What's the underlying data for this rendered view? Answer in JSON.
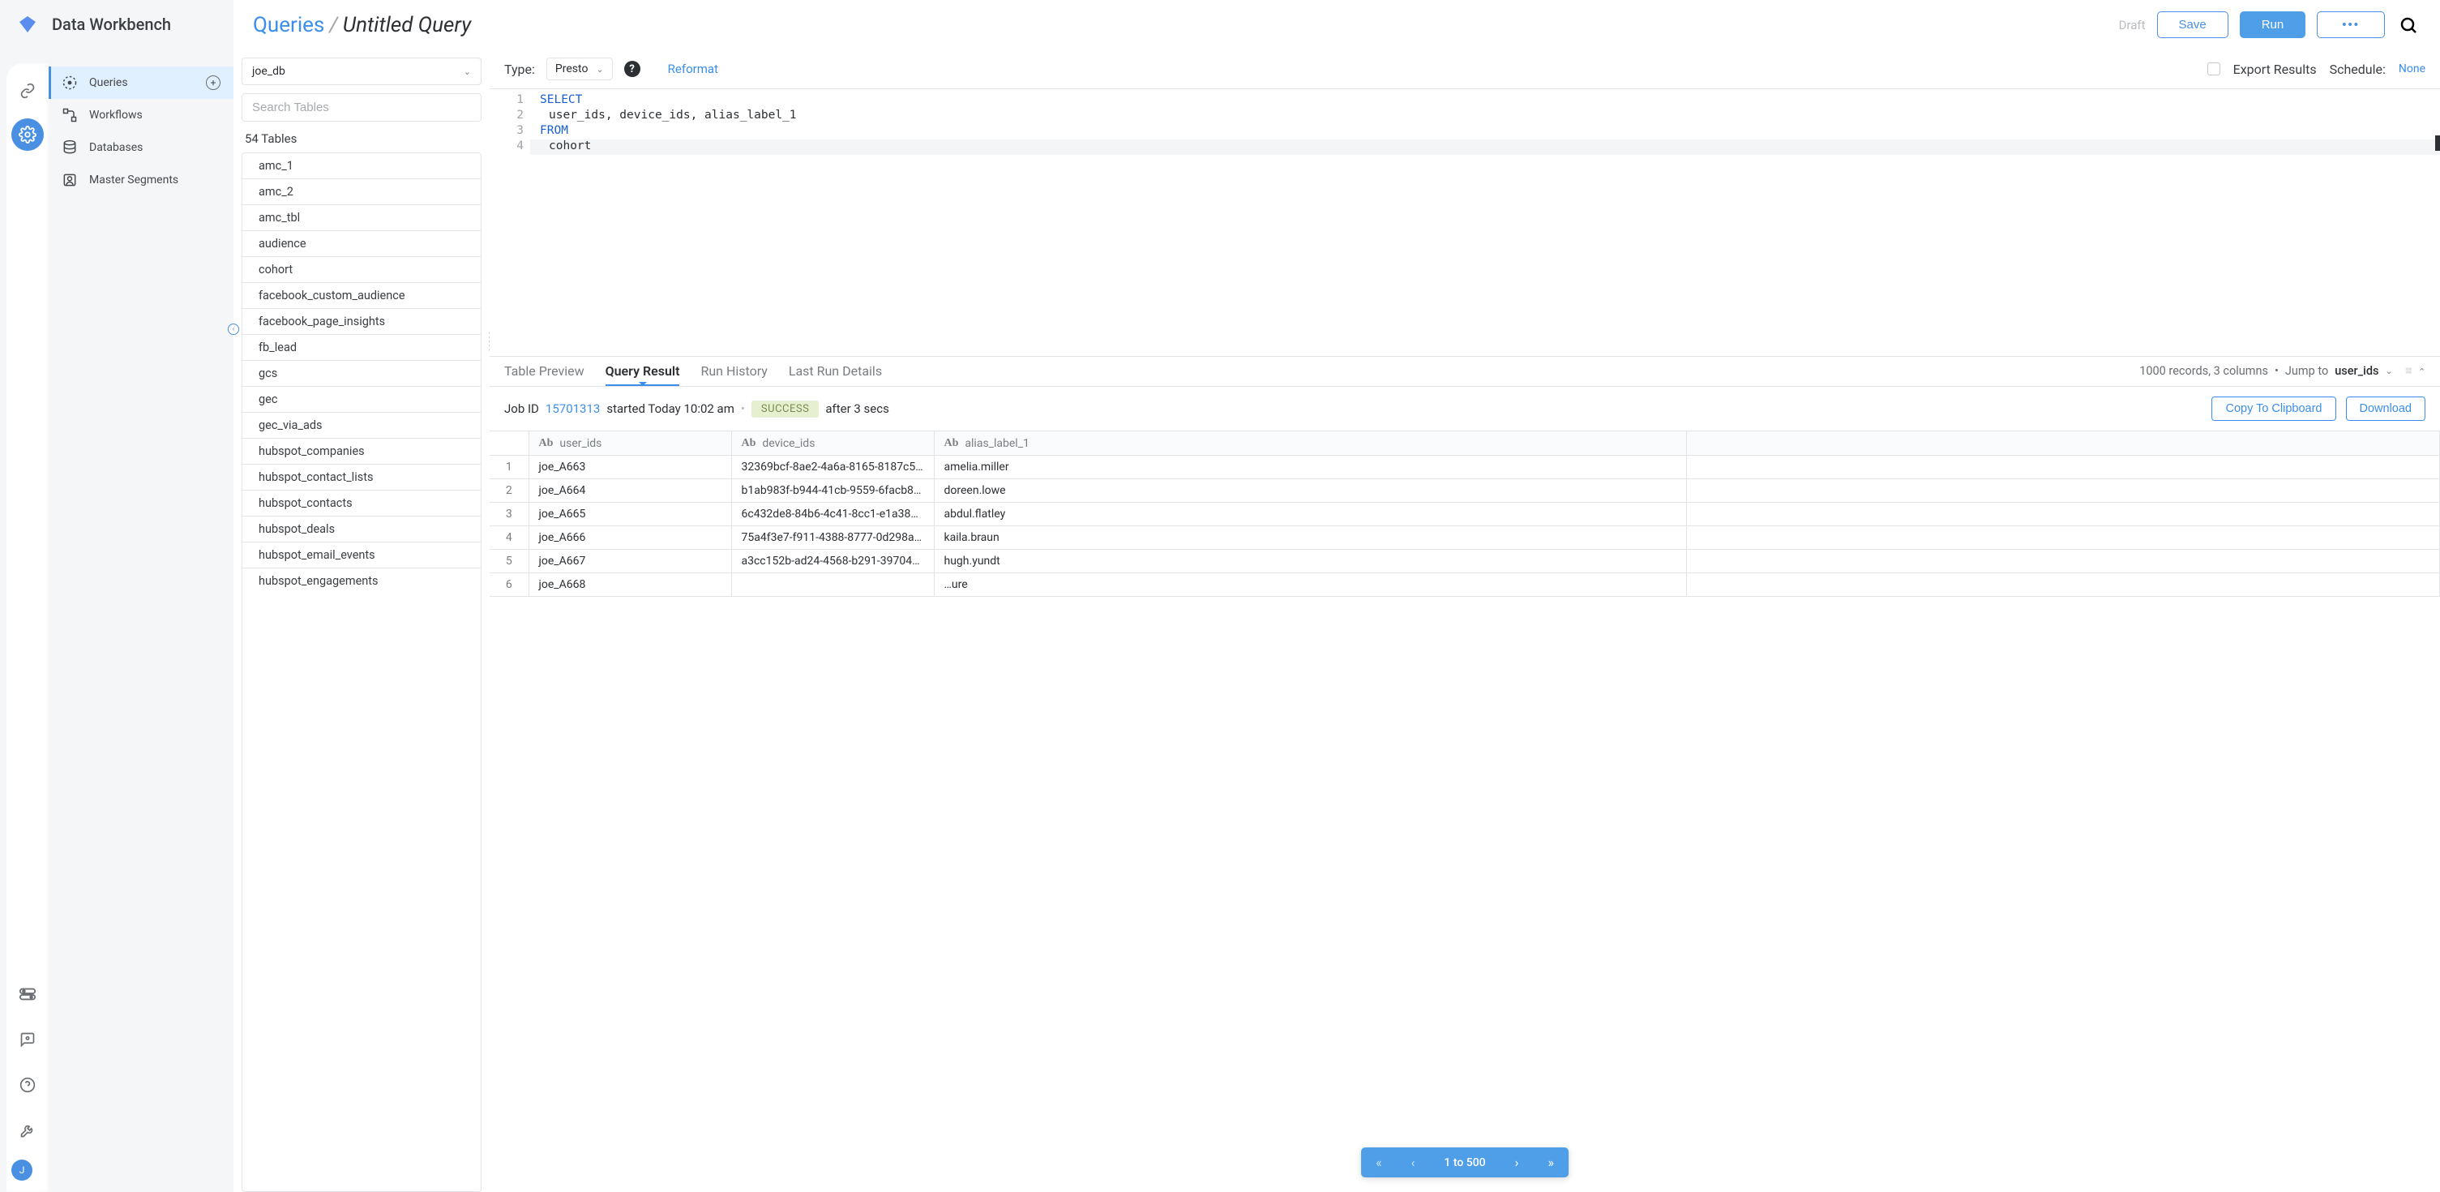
{
  "brand": {
    "name": "Data Workbench",
    "avatar_initial": "J"
  },
  "nav": {
    "items": [
      {
        "label": "Queries",
        "icon": "query-icon",
        "active": true,
        "plus": true
      },
      {
        "label": "Workflows",
        "icon": "workflow-icon"
      },
      {
        "label": "Databases",
        "icon": "database-icon"
      },
      {
        "label": "Master Segments",
        "icon": "segments-icon"
      }
    ]
  },
  "breadcrumb": {
    "root": "Queries",
    "sep": "/",
    "leaf": "Untitled Query"
  },
  "topbar": {
    "draft": "Draft",
    "save": "Save",
    "run": "Run",
    "more": "•••"
  },
  "tables_panel": {
    "db_selected": "joe_db",
    "search_placeholder": "Search Tables",
    "count_label": "54 Tables",
    "tables": [
      "amc_1",
      "amc_2",
      "amc_tbl",
      "audience",
      "cohort",
      "facebook_custom_audience",
      "facebook_page_insights",
      "fb_lead",
      "gcs",
      "gec",
      "gec_via_ads",
      "hubspot_companies",
      "hubspot_contact_lists",
      "hubspot_contacts",
      "hubspot_deals",
      "hubspot_email_events",
      "hubspot_engagements"
    ]
  },
  "query_toolbar": {
    "type_label": "Type:",
    "type_value": "Presto",
    "reformat": "Reformat",
    "export_label": "Export Results",
    "schedule_label": "Schedule:",
    "schedule_value": "None"
  },
  "editor": {
    "lines": [
      {
        "n": "1",
        "tokens": [
          {
            "t": "SELECT",
            "cls": "kw"
          }
        ]
      },
      {
        "n": "2",
        "tokens": [
          {
            "t": "  user_ids, device_ids, alias_label_1",
            "cls": "ident"
          }
        ]
      },
      {
        "n": "3",
        "tokens": [
          {
            "t": "FROM",
            "cls": "kw"
          }
        ]
      },
      {
        "n": "4",
        "hl": true,
        "tokens": [
          {
            "t": "  cohort",
            "cls": "ident"
          }
        ]
      }
    ]
  },
  "results": {
    "tabs": [
      "Table Preview",
      "Query Result",
      "Run History",
      "Last Run Details"
    ],
    "active_tab": "Query Result",
    "summary": "1000 records, 3 columns",
    "jump_label": "Jump to",
    "jump_field": "user_ids",
    "job": {
      "prefix": "Job ID",
      "id": "15701313",
      "started": "started Today 10:02 am",
      "status": "SUCCESS",
      "duration": "after 3 secs",
      "copy": "Copy To Clipboard",
      "download": "Download"
    },
    "columns": [
      "user_ids",
      "device_ids",
      "alias_label_1"
    ],
    "rows": [
      {
        "n": "1",
        "user_ids": "joe_A663",
        "device_ids": "32369bcf-8ae2-4a6a-8165-8187c5…",
        "alias": "amelia.miller"
      },
      {
        "n": "2",
        "user_ids": "joe_A664",
        "device_ids": "b1ab983f-b944-41cb-9559-6facb84…",
        "alias": "doreen.lowe"
      },
      {
        "n": "3",
        "user_ids": "joe_A665",
        "device_ids": "6c432de8-84b6-4c41-8cc1-e1a38a…",
        "alias": "abdul.flatley"
      },
      {
        "n": "4",
        "user_ids": "joe_A666",
        "device_ids": "75a4f3e7-f911-4388-8777-0d298a…",
        "alias": "kaila.braun"
      },
      {
        "n": "5",
        "user_ids": "joe_A667",
        "device_ids": "a3cc152b-ad24-4568-b291-39704c…",
        "alias": "hugh.yundt"
      },
      {
        "n": "6",
        "user_ids": "joe_A668",
        "device_ids": "",
        "alias": "…ure"
      }
    ],
    "paginator": {
      "label": "1 to 500"
    }
  }
}
